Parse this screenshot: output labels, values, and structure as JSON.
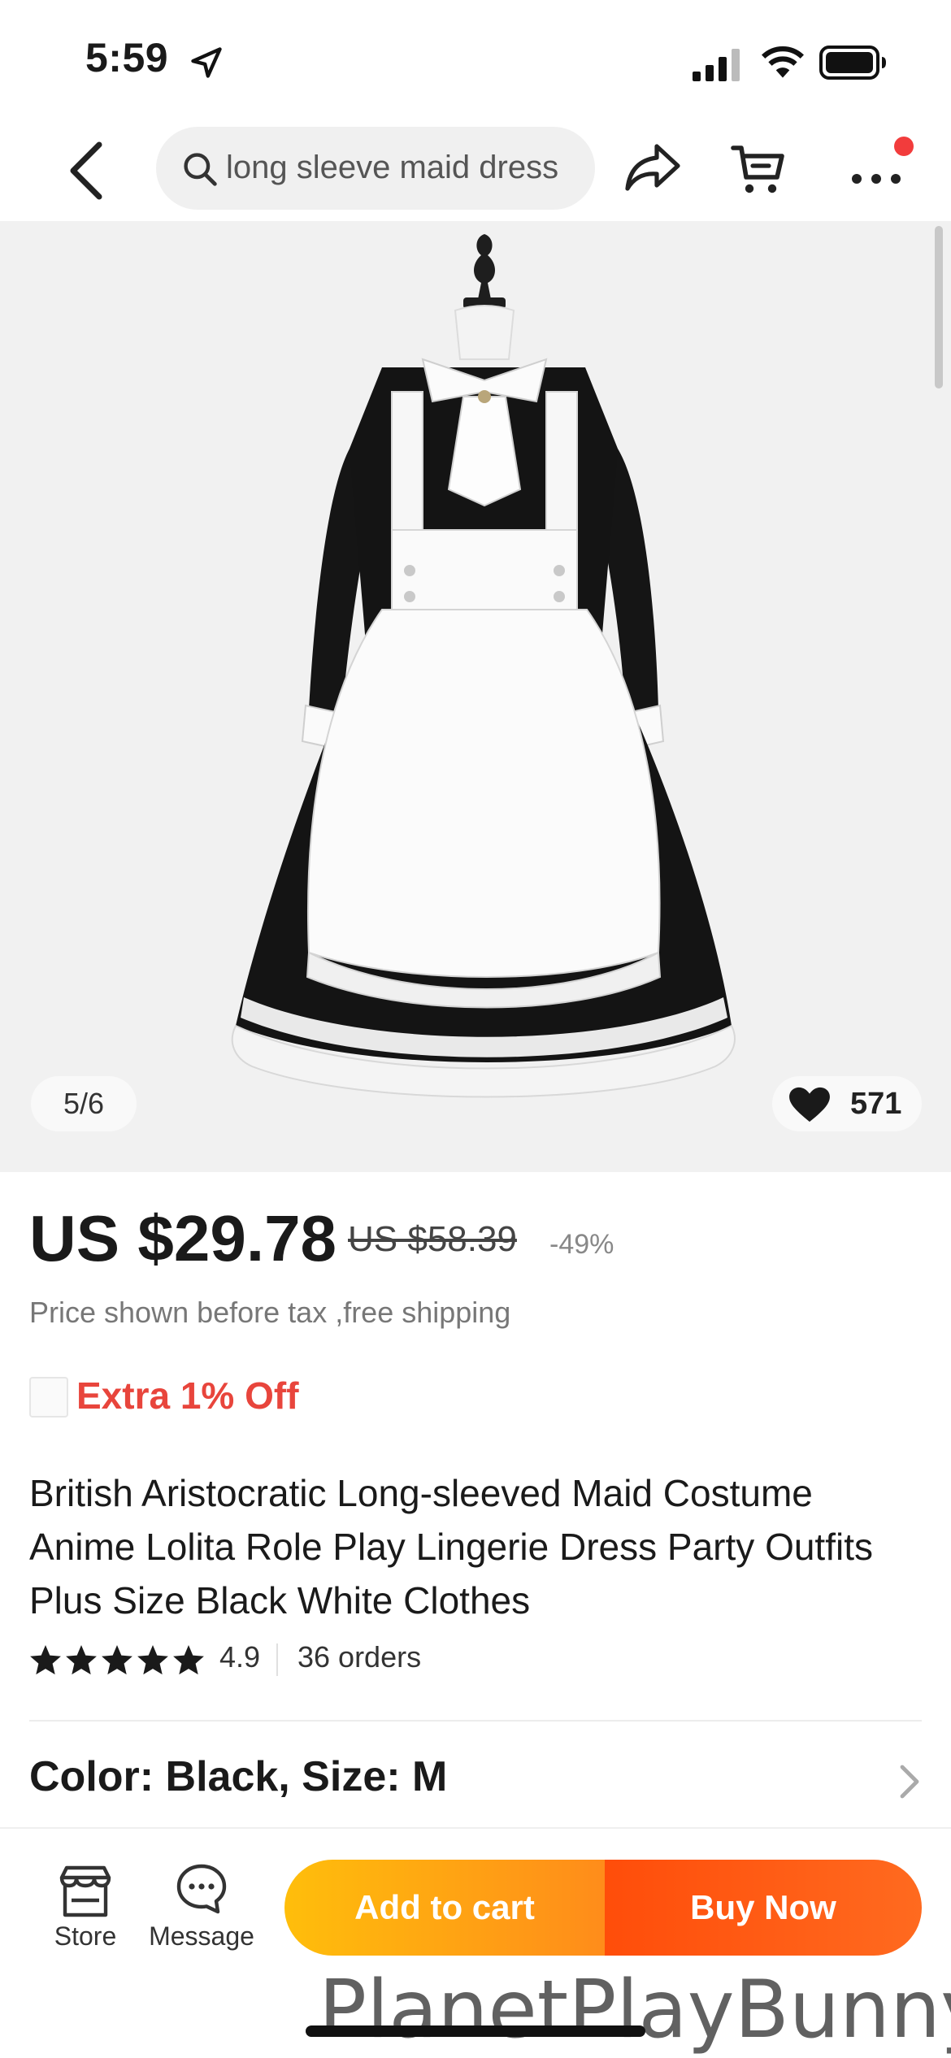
{
  "status_bar": {
    "time": "5:59",
    "icons": [
      "location-arrow-icon",
      "signal-icon",
      "wifi-icon",
      "battery-icon"
    ]
  },
  "nav": {
    "search_text": "long sleeve maid dress",
    "icons": [
      "back-icon",
      "search-icon",
      "share-icon",
      "cart-icon",
      "more-icon"
    ],
    "notification_color": "#f23c3c"
  },
  "gallery": {
    "counter": "5/6",
    "wishlist_count": "571"
  },
  "product": {
    "price": "US $29.78",
    "original_price": "US $58.39",
    "discount": "-49%",
    "tax_note": "Price shown before tax ,free shipping",
    "coupon": "Extra 1% Off",
    "title": "British Aristocratic Long-sleeved Maid Costume Anime Lolita Role Play Lingerie Dress Party Outfits Plus Size Black White Clothes",
    "rating": "4.9",
    "rating_stars": 5,
    "orders": "36 orders",
    "variant": "Color: Black, Size: M"
  },
  "bottom_bar": {
    "store_label": "Store",
    "message_label": "Message",
    "add_to_cart": "Add to cart",
    "buy_now": "Buy Now",
    "colors": {
      "add_to_cart": "#ffa614",
      "buy_now": "#ff5210"
    }
  },
  "watermark": "PlanetPlayBunny"
}
